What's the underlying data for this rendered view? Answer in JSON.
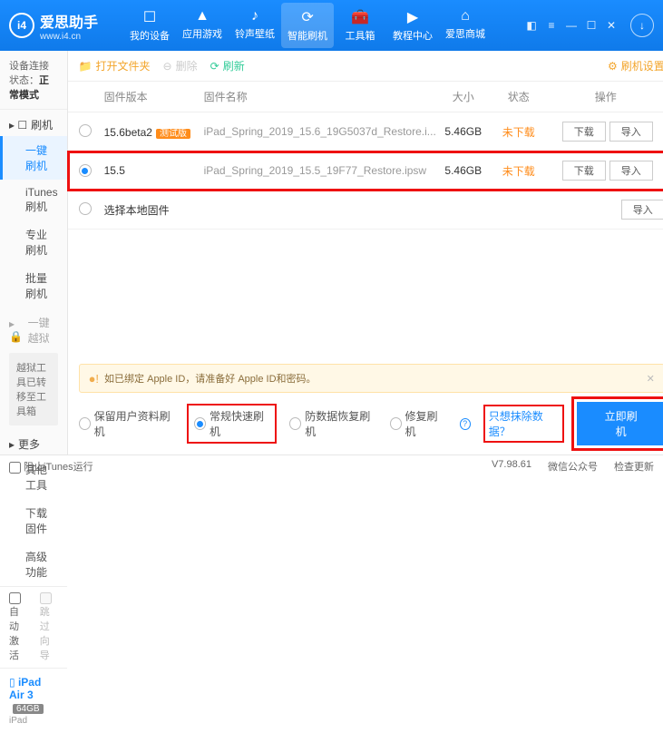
{
  "brand": {
    "name": "爱思助手",
    "url": "www.i4.cn"
  },
  "nav": [
    {
      "icon": "☐",
      "label": "我的设备"
    },
    {
      "icon": "▲",
      "label": "应用游戏"
    },
    {
      "icon": "♪",
      "label": "铃声壁纸"
    },
    {
      "icon": "⟳",
      "label": "智能刷机"
    },
    {
      "icon": "🧰",
      "label": "工具箱"
    },
    {
      "icon": "▶",
      "label": "教程中心"
    },
    {
      "icon": "⌂",
      "label": "爱思商城"
    }
  ],
  "sidebar": {
    "conn_label": "设备连接状态：",
    "conn_value": "正常模式",
    "groups": {
      "flash": {
        "title": "刷机",
        "items": [
          "一键刷机",
          "iTunes刷机",
          "专业刷机",
          "批量刷机"
        ]
      },
      "jail": {
        "title": "一键越狱",
        "note": "越狱工具已转移至工具箱"
      },
      "more": {
        "title": "更多",
        "items": [
          "其他工具",
          "下载固件",
          "高级功能"
        ]
      }
    },
    "auto_activate": "自动激活",
    "skip_guide": "跳过向导",
    "device_name": "iPad Air 3",
    "device_storage": "64GB",
    "device_type": "iPad"
  },
  "toolbar": {
    "open": "打开文件夹",
    "delete": "删除",
    "refresh": "刷新",
    "settings": "刷机设置"
  },
  "table": {
    "h_ver": "固件版本",
    "h_name": "固件名称",
    "h_size": "大小",
    "h_stat": "状态",
    "h_act": "操作",
    "rows": [
      {
        "ver": "15.6beta2",
        "badge": "测试版",
        "name": "iPad_Spring_2019_15.6_19G5037d_Restore.i...",
        "size": "5.46GB",
        "stat": "未下载",
        "dl": "下载",
        "imp": "导入",
        "sel": false
      },
      {
        "ver": "15.5",
        "badge": "",
        "name": "iPad_Spring_2019_15.5_19F77_Restore.ipsw",
        "size": "5.46GB",
        "stat": "未下载",
        "dl": "下载",
        "imp": "导入",
        "sel": true
      }
    ],
    "local_label": "选择本地固件",
    "local_imp": "导入"
  },
  "warning": "如已绑定 Apple ID，请准备好 Apple ID和密码。",
  "modes": {
    "keep": "保留用户资料刷机",
    "normal": "常规快速刷机",
    "protect": "防数据恢复刷机",
    "repair": "修复刷机",
    "clear": "只想抹除数据？",
    "start": "立即刷机"
  },
  "footer": {
    "block": "阻止iTunes运行",
    "ver": "V7.98.61",
    "wechat": "微信公众号",
    "update": "检查更新"
  }
}
